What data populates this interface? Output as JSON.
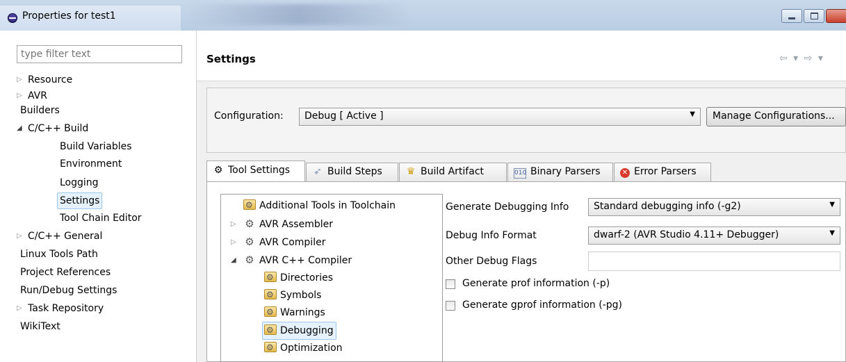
{
  "window": {
    "title": "Properties for test1"
  },
  "left_pane": {
    "filter_placeholder": "type filter text",
    "tree": [
      {
        "label": "Resource",
        "twisty": "closed"
      },
      {
        "label": "AVR",
        "twisty": "closed"
      },
      {
        "label": "Builders",
        "twisty": "none"
      },
      {
        "label": "C/C++ Build",
        "twisty": "open"
      },
      {
        "label": "Build Variables",
        "twisty": "none"
      },
      {
        "label": "Environment",
        "twisty": "none"
      },
      {
        "label": "Logging",
        "twisty": "none"
      },
      {
        "label": "Settings",
        "twisty": "none",
        "selected": true
      },
      {
        "label": "Tool Chain Editor",
        "twisty": "none"
      },
      {
        "label": "C/C++ General",
        "twisty": "closed"
      },
      {
        "label": "Linux Tools Path",
        "twisty": "none"
      },
      {
        "label": "Project References",
        "twisty": "none"
      },
      {
        "label": "Run/Debug Settings",
        "twisty": "none"
      },
      {
        "label": "Task Repository",
        "twisty": "closed"
      },
      {
        "label": "WikiText",
        "twisty": "none"
      }
    ]
  },
  "header": {
    "title": "Settings"
  },
  "configuration": {
    "label": "Configuration:",
    "value": "Debug  [ Active ]",
    "manage_button": "Manage Configurations..."
  },
  "tabs": [
    {
      "label": "Tool Settings",
      "icon": "gear-icon",
      "active": true
    },
    {
      "label": "Build Steps",
      "icon": "build-steps-icon"
    },
    {
      "label": "Build Artifact",
      "icon": "trophy-icon"
    },
    {
      "label": "Binary Parsers",
      "icon": "binary-icon"
    },
    {
      "label": "Error Parsers",
      "icon": "error-icon"
    }
  ],
  "tool_tree": [
    {
      "label": "Additional Tools in Toolchain",
      "icon": "tool-folder-icon"
    },
    {
      "label": "AVR Assembler",
      "icon": "gear-icon",
      "twisty": "closed"
    },
    {
      "label": "AVR Compiler",
      "icon": "gear-icon",
      "twisty": "closed"
    },
    {
      "label": "AVR C++ Compiler",
      "icon": "gear-icon",
      "twisty": "open"
    },
    {
      "label": "Directories",
      "icon": "tool-folder-icon"
    },
    {
      "label": "Symbols",
      "icon": "tool-folder-icon"
    },
    {
      "label": "Warnings",
      "icon": "tool-folder-icon"
    },
    {
      "label": "Debugging",
      "icon": "tool-folder-icon",
      "selected": true
    },
    {
      "label": "Optimization",
      "icon": "tool-folder-icon"
    }
  ],
  "debug_options": {
    "generate_debug_info_label": "Generate Debugging Info",
    "generate_debug_info_value": "Standard debugging info (-g2)",
    "debug_info_format_label": "Debug Info Format",
    "debug_info_format_value": "dwarf-2 (AVR Studio 4.11+ Debugger)",
    "other_debug_flags_label": "Other Debug Flags",
    "other_debug_flags_value": "",
    "prof_label": "Generate prof information (-p)",
    "prof_checked": false,
    "gprof_label": "Generate gprof information (-pg)",
    "gprof_checked": false
  },
  "colors": {
    "selection_bg": "#e5f1fb",
    "selection_border": "#9cc7ea",
    "close_button": "#c8412c"
  }
}
